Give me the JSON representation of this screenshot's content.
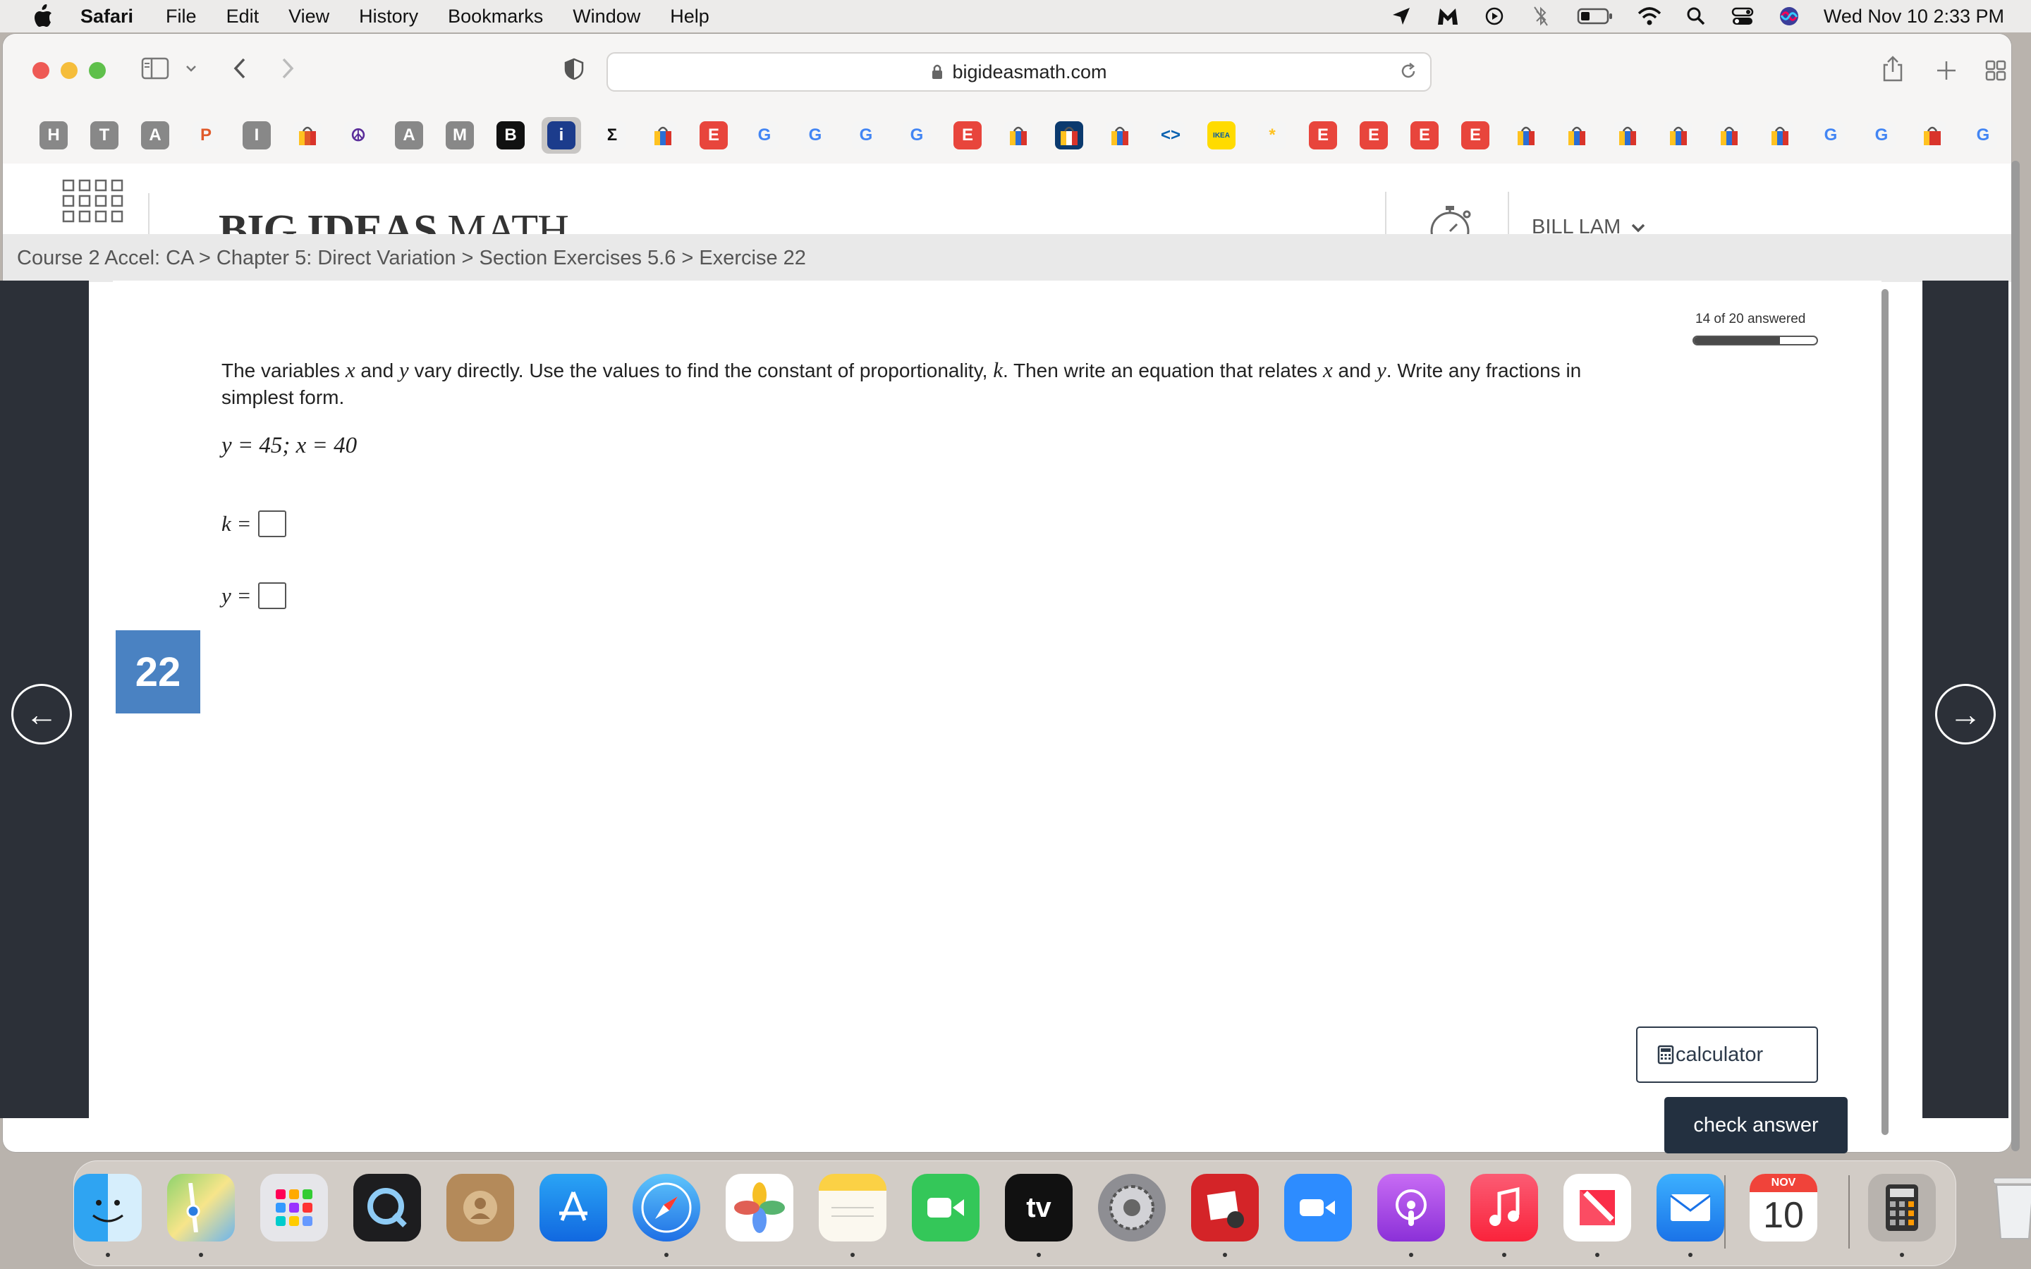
{
  "menubar": {
    "app_name": "Safari",
    "menus": [
      "File",
      "Edit",
      "View",
      "History",
      "Bookmarks",
      "Window",
      "Help"
    ],
    "clock": "Wed Nov 10  2:33 PM",
    "status_icons": [
      "location-arrow-icon",
      "malwarebytes-icon",
      "play-circle-icon",
      "bluetooth-icon",
      "battery-icon",
      "wifi-icon",
      "spotlight-search-icon",
      "control-center-icon",
      "siri-icon"
    ]
  },
  "browser": {
    "url": "bigideasmath.com",
    "favorites": [
      "H",
      "T",
      "A",
      "P",
      "I",
      "",
      "☮",
      "A",
      "M",
      "B",
      "i",
      "Σ",
      "",
      "E",
      "G",
      "G",
      "G",
      "G",
      "E",
      "",
      "",
      "",
      "<>",
      "IKEA",
      "*",
      "E",
      "E",
      "E",
      "E",
      "",
      "",
      "",
      "",
      "",
      "",
      "G",
      "G",
      "",
      "G"
    ]
  },
  "header": {
    "logo_bold": "BIG IDEAS",
    "logo_light": " MATH",
    "user_name": "BILL LAM"
  },
  "breadcrumb": "Course 2 Accel: CA > Chapter 5: Direct Variation > Section Exercises 5.6 > Exercise 22",
  "progress": {
    "text": "14 of 20 answered",
    "answered": 14,
    "total": 20
  },
  "question": {
    "text_1": "The variables ",
    "var_x": "x",
    "text_2": " and ",
    "var_y": "y",
    "text_3": " vary directly. Use the values to find the constant of proportionality, ",
    "var_k": "k",
    "text_4": ". Then write an equation that relates ",
    "text_5": " and ",
    "text_6": ". Write any fractions in simplest form.",
    "given": "y = 45;  x = 40",
    "k_label": "k =",
    "y_label": "y ="
  },
  "exercise_number": "22",
  "buttons": {
    "calculator": "calculator",
    "check_answer": "check answer",
    "prev_arrow": "←",
    "next_arrow": "→"
  },
  "dock": {
    "calendar_month": "NOV",
    "calendar_day": "10",
    "appletv_label": "tv"
  }
}
